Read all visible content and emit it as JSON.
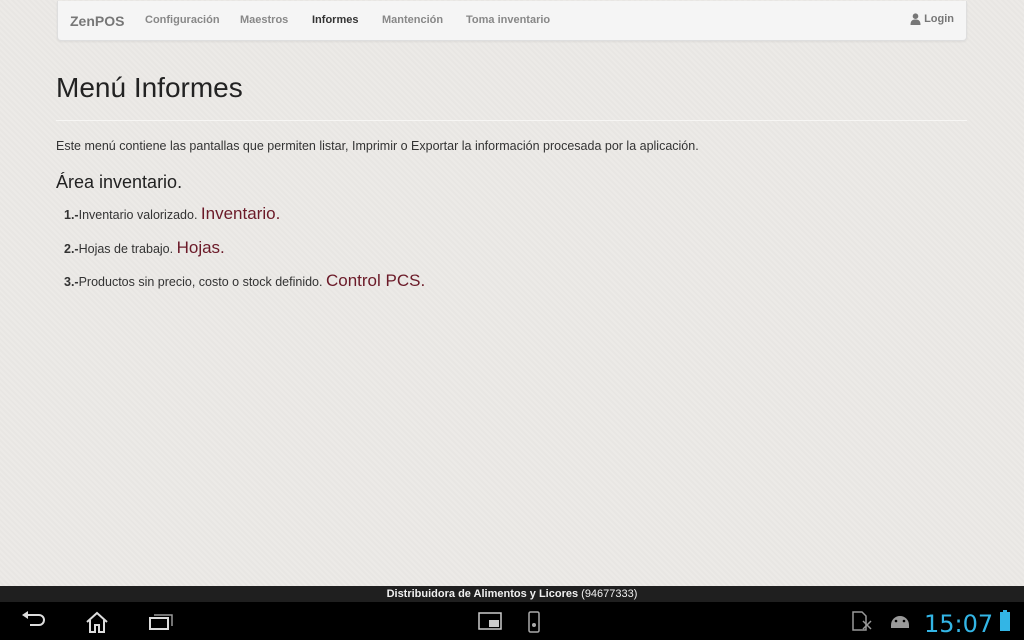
{
  "navbar": {
    "brand": "ZenPOS",
    "items": [
      {
        "label": "Configuración"
      },
      {
        "label": "Maestros"
      },
      {
        "label": "Informes",
        "active": true
      },
      {
        "label": "Mantención"
      },
      {
        "label": "Toma inventario"
      }
    ],
    "login_label": "Login"
  },
  "main": {
    "title": "Menú Informes",
    "intro": "Este menú contiene las pantallas que permiten listar, Imprimir o Exportar la información procesada por la aplicación.",
    "section_title": "Área inventario.",
    "items": [
      {
        "number": "1.-",
        "text": "Inventario valorizado.",
        "link": "Inventario."
      },
      {
        "number": "2.-",
        "text": "Hojas de trabajo.",
        "link": "Hojas."
      },
      {
        "number": "3.-",
        "text": "Productos sin precio, costo o stock definido.",
        "link": "Control PCS."
      }
    ]
  },
  "footer": {
    "store_name": "Distribuidora de Alimentos y Licores",
    "phone": "(94677333)"
  },
  "system_bar": {
    "time": "15:07",
    "icons": [
      "back-icon",
      "home-icon",
      "recent-apps-icon",
      "screenshot-icon",
      "usb-icon",
      "sdcard-icon",
      "android-debug-icon",
      "battery-icon"
    ]
  },
  "colors": {
    "link": "#6b1a28",
    "clock": "#33b5e5",
    "page_bg": "#ebe9e6"
  }
}
